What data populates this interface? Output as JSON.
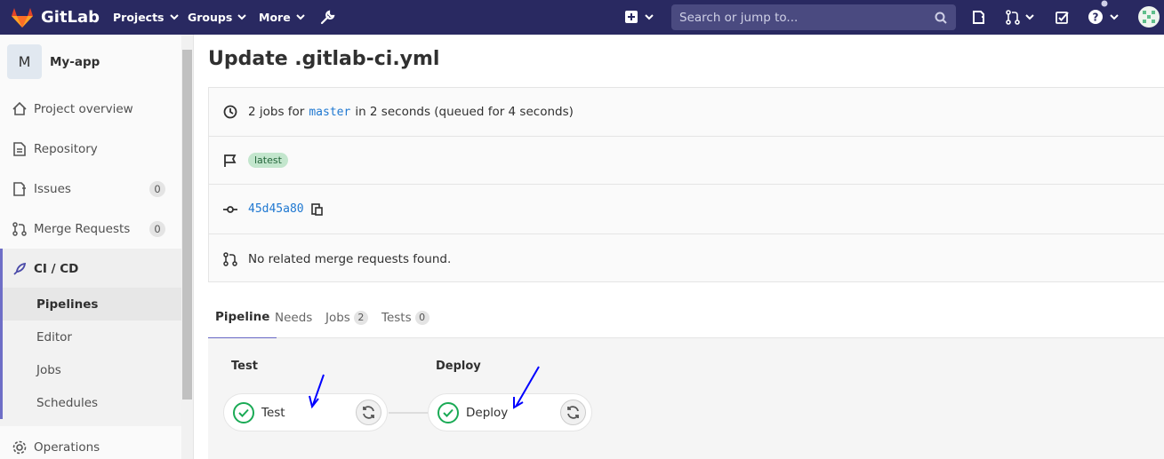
{
  "navbar": {
    "logo_text": "GitLab",
    "projects": "Projects",
    "groups": "Groups",
    "more": "More",
    "search_placeholder": "Search or jump to..."
  },
  "sidebar": {
    "avatar_letter": "M",
    "project_name": "My-app",
    "items": [
      {
        "label": "Project overview"
      },
      {
        "label": "Repository"
      },
      {
        "label": "Issues",
        "count": "0"
      },
      {
        "label": "Merge Requests",
        "count": "0"
      },
      {
        "label": "CI / CD"
      },
      {
        "label": "Operations"
      }
    ],
    "cicd_sub": [
      "Pipelines",
      "Editor",
      "Jobs",
      "Schedules"
    ]
  },
  "page": {
    "title": "Update .gitlab-ci.yml",
    "jobs_prefix": "2 jobs for",
    "branch": "master",
    "jobs_suffix": "in 2 seconds (queued for 4 seconds)",
    "latest_badge": "latest",
    "commit_sha": "45d45a80",
    "no_mr": "No related merge requests found."
  },
  "tabs": [
    {
      "label": "Pipeline"
    },
    {
      "label": "Needs"
    },
    {
      "label": "Jobs",
      "count": "2"
    },
    {
      "label": "Tests",
      "count": "0"
    }
  ],
  "pipeline": {
    "stages": [
      {
        "title": "Test",
        "job": "Test"
      },
      {
        "title": "Deploy",
        "job": "Deploy"
      }
    ]
  },
  "colors": {
    "navbar": "#292961",
    "success": "#1aaa55",
    "link": "#1f78d1",
    "annotation": "#0000ff"
  }
}
